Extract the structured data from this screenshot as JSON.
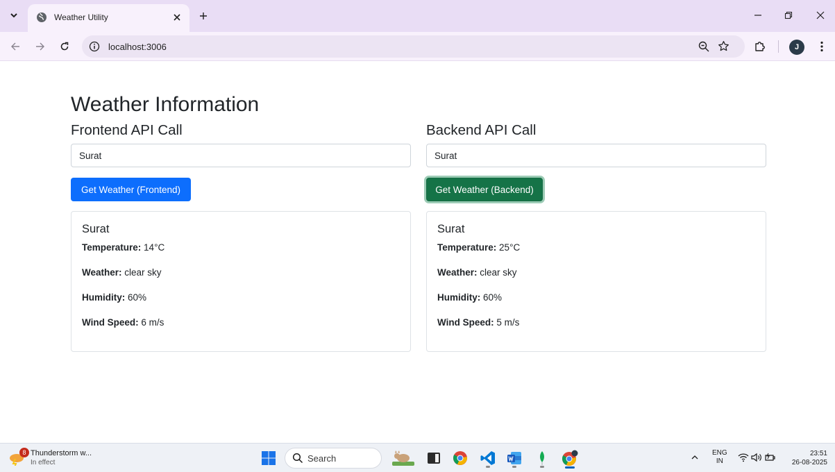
{
  "browser": {
    "tab_title": "Weather Utility",
    "url": "localhost:3006",
    "profile_initial": "J"
  },
  "page": {
    "title": "Weather Information",
    "frontend": {
      "heading": "Frontend API Call",
      "input_value": "Surat",
      "button_label": "Get Weather (Frontend)",
      "result": {
        "city": "Surat",
        "temperature_label": "Temperature:",
        "temperature_value": "14°C",
        "weather_label": "Weather:",
        "weather_value": "clear sky",
        "humidity_label": "Humidity:",
        "humidity_value": "60%",
        "wind_label": "Wind Speed:",
        "wind_value": "6 m/s"
      }
    },
    "backend": {
      "heading": "Backend API Call",
      "input_value": "Surat",
      "button_label": "Get Weather (Backend)",
      "result": {
        "city": "Surat",
        "temperature_label": "Temperature:",
        "temperature_value": "25°C",
        "weather_label": "Weather:",
        "weather_value": "clear sky",
        "humidity_label": "Humidity:",
        "humidity_value": "60%",
        "wind_label": "Wind Speed:",
        "wind_value": "5 m/s"
      }
    }
  },
  "taskbar": {
    "weather_badge": "8",
    "weather_title": "Thunderstorm w...",
    "weather_sub": "In effect",
    "search_label": "Search",
    "lang_top": "ENG",
    "lang_bottom": "IN",
    "time": "23:51",
    "date": "26-08-2025"
  },
  "colors": {
    "primary": "#0d6efd",
    "success": "#157347",
    "chrome_bg": "#e9ddf5"
  }
}
